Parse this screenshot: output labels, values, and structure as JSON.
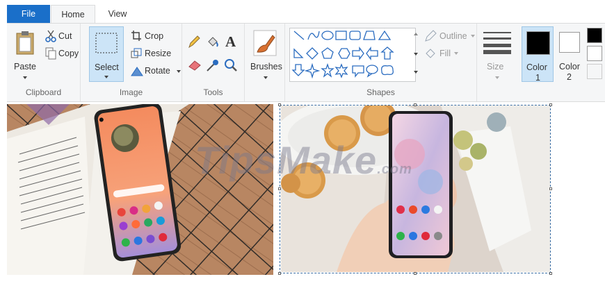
{
  "tabs": {
    "file": "File",
    "home": "Home",
    "view": "View"
  },
  "clipboard": {
    "paste": "Paste",
    "cut": "Cut",
    "copy": "Copy",
    "group": "Clipboard"
  },
  "image": {
    "select": "Select",
    "crop": "Crop",
    "resize": "Resize",
    "rotate": "Rotate",
    "group": "Image"
  },
  "tools": {
    "group": "Tools"
  },
  "brushes": {
    "label": "Brushes"
  },
  "shapes": {
    "group": "Shapes",
    "outline": "Outline",
    "fill": "Fill"
  },
  "size": {
    "label": "Size"
  },
  "colors": {
    "color1": "Color",
    "color1_num": "1",
    "color2": "Color",
    "color2_num": "2",
    "color1_value": "#000000",
    "color2_value": "#ffffff"
  },
  "watermark": {
    "text": "TipsMake",
    "suffix": ".com"
  }
}
